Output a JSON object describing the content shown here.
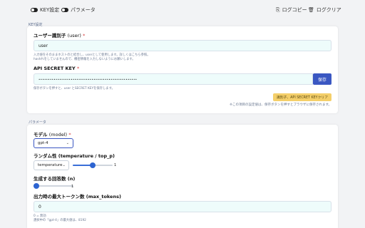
{
  "topbar": {
    "key_toggle_label": "KEY設定",
    "param_toggle_label": "パラメータ",
    "log_copy_label": "ログコピー",
    "log_clear_label": "ログクリア"
  },
  "key_section": {
    "title": "KEY設定",
    "user_id": {
      "label": "ユーザー識別子",
      "param": "(user)",
      "required_mark": "*",
      "value": "user",
      "help_1": "入力値をそのままホストのと結合し、userとして使用します。詳しくはこちら参照。",
      "help_2": "hashれをしていませんので、機密情報を入力しないようにお願いします。"
    },
    "api_key": {
      "label": "API SECRET KEY",
      "required_mark": "*",
      "value": "••••••••••••••••••••••••••••••••••••••••••••••••••••",
      "save_label": "保存",
      "help": "保存ボタンを押すと、user とSECRET KEYを保存します。"
    },
    "clear_button_label": "識別子、API SECRET KEYクリア",
    "note": "※この項目の設定値は、保存ボタンを押すとブラウザに保存されます。"
  },
  "param_section": {
    "title": "パラメータ",
    "model": {
      "label": "モデル",
      "param": "(model)",
      "required_mark": "*",
      "selected": "gpt-4"
    },
    "randomness": {
      "label": "ランダム性 (temperature / top_p)",
      "selected": "temperature",
      "value_text": "1",
      "value_fraction": 0.5
    },
    "n": {
      "label": "生成する回答数 (n)",
      "value_text": "1",
      "value_fraction": 0.0
    },
    "max_tokens": {
      "label": "出力時の最大トークン数 (max_tokens)",
      "value": "0",
      "help_1": "0 = 無効",
      "help_2": "選択中の「gpt-4」の最大値は、8192"
    }
  },
  "colors": {
    "accent": "#3a57c2",
    "input_bg": "#eefcfb",
    "clear_button": "#f4cf6a",
    "required": "#d43838"
  },
  "icons": [
    "toggle-icon",
    "trash-icon",
    "copy-icon",
    "chevron-down-icon"
  ]
}
